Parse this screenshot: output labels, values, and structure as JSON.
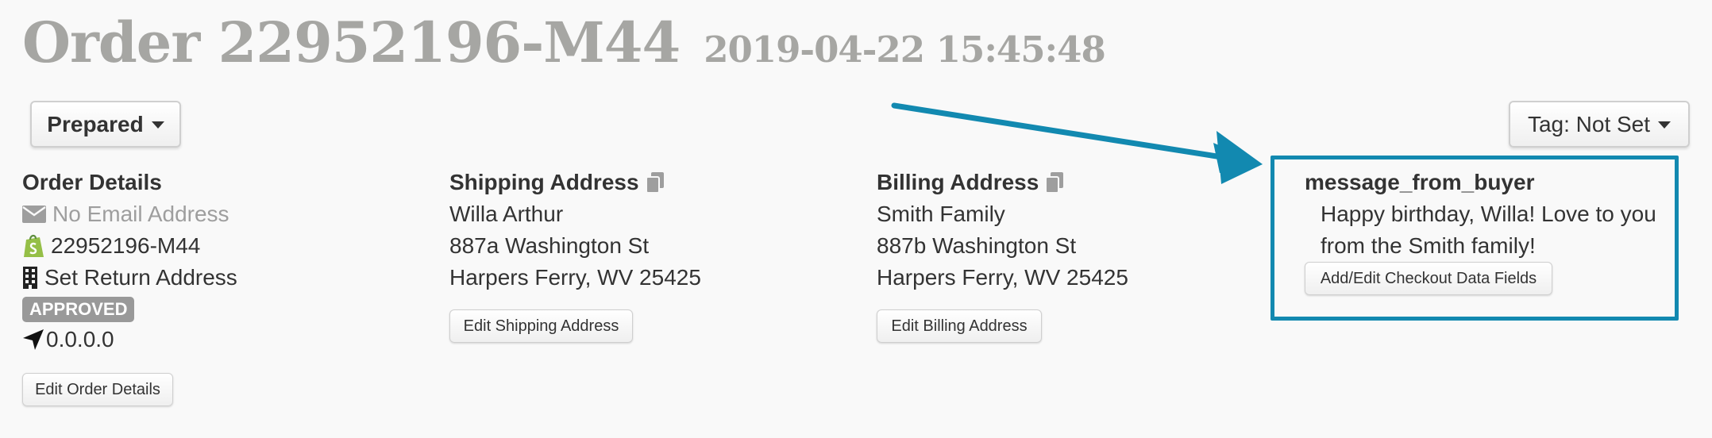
{
  "header": {
    "title": "Order 22952196-M44",
    "datetime": "2019-04-22 15:45:48"
  },
  "status_button": {
    "label": "Prepared"
  },
  "tag_button": {
    "label": "Tag: Not Set"
  },
  "order_details": {
    "heading": "Order Details",
    "email": "No Email Address",
    "store_order_id": "22952196-M44",
    "return_address": "Set Return Address",
    "status_badge": "APPROVED",
    "ip_address": "0.0.0.0",
    "edit_label": "Edit Order Details"
  },
  "shipping": {
    "heading": "Shipping Address",
    "name": "Willa Arthur",
    "street": "887a Washington St",
    "city_state_zip": "Harpers Ferry, WV 25425",
    "edit_label": "Edit Shipping Address"
  },
  "billing": {
    "heading": "Billing Address",
    "name": "Smith Family",
    "street": "887b Washington St",
    "city_state_zip": "Harpers Ferry, WV 25425",
    "edit_label": "Edit Billing Address"
  },
  "checkout_data": {
    "field_name": "message_from_buyer",
    "field_value": "Happy birthday, Willa! Love to you from the Smith family!",
    "edit_label": "Add/Edit Checkout Data Fields"
  },
  "colors": {
    "title_gray": "#a6a6a3",
    "annotation_blue": "#1289b0",
    "shopify_green": "#95bf47",
    "badge_gray": "#999999"
  }
}
